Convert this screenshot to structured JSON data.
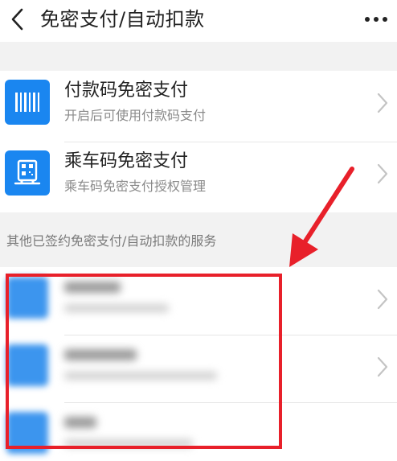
{
  "navbar": {
    "title": "免密支付/自动扣款",
    "back_icon": "chevron-left-icon",
    "more_icon": "more-horizontal-icon"
  },
  "items": [
    {
      "title": "付款码免密支付",
      "subtitle": "开启后可使用付款码支付",
      "icon": "barcode-icon"
    },
    {
      "title": "乘车码免密支付",
      "subtitle": "乘车码免密支付授权管理",
      "icon": "transit-qr-icon"
    }
  ],
  "section": {
    "header": "其他已签约免密支付/自动扣款的服务"
  },
  "services_blurred": [
    {
      "icon": "blurred-app-icon"
    },
    {
      "icon": "blurred-app-icon"
    },
    {
      "icon": "blurred-app-icon"
    }
  ],
  "colors": {
    "accent": "#1a86f0",
    "highlight": "#e8202a",
    "background_gray": "#f2f2f2"
  }
}
